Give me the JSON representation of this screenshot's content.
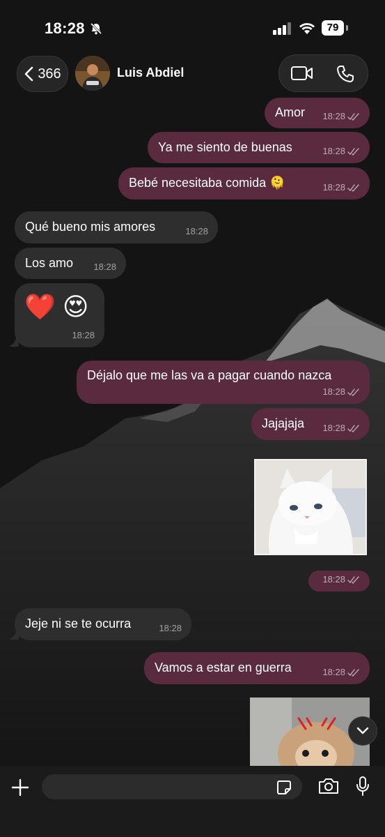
{
  "status_bar": {
    "time": "18:28",
    "battery": "79"
  },
  "header": {
    "back_count": "366",
    "contact_name": "Luis Abdiel"
  },
  "messages": [
    {
      "text": "Amor",
      "time": "18:28"
    },
    {
      "text": "Ya me siento de buenas",
      "time": "18:28"
    },
    {
      "text": "Bebé necesitaba comida 🫠",
      "time": "18:28"
    },
    {
      "text": "Qué bueno mis amores",
      "time": "18:28"
    },
    {
      "text": "Los amo",
      "time": "18:28"
    },
    {
      "text": "❤️ 😍",
      "time": "18:28"
    },
    {
      "text": "Déjalo que me las va a pagar cuando nazca",
      "time": "18:28"
    },
    {
      "text": "Jajajaja",
      "time": "18:28"
    },
    {
      "text": "",
      "time": "18:28"
    },
    {
      "text": "Jeje ni se te ocurra",
      "time": "18:28"
    },
    {
      "text": "Vamos a estar en guerra",
      "time": "18:28"
    }
  ],
  "composer": {
    "placeholder": ""
  },
  "icons": {
    "back": "chevron-left-icon",
    "video": "video-camera-icon",
    "phone": "phone-icon",
    "plus": "plus-icon",
    "sticker": "sticker-icon",
    "camera": "camera-icon",
    "mic": "microphone-icon",
    "scroll": "chevron-down-icon"
  },
  "colors": {
    "outgoing_bubble": "#5a2a3f",
    "incoming_bubble": "#2e2e2e",
    "background": "#141414"
  }
}
